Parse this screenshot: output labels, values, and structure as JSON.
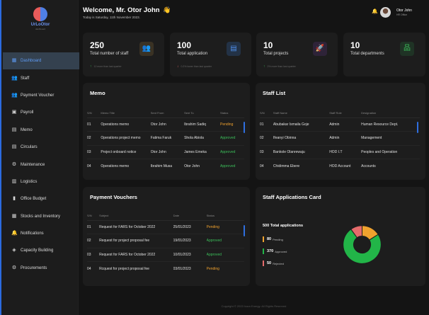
{
  "logo": {
    "title": "UrLoOtor",
    "subtitle": "dashboard"
  },
  "sidebar": {
    "items": [
      {
        "label": "Dashboard",
        "icon": "dashboard-icon",
        "glyph": "▦"
      },
      {
        "label": "Staff",
        "icon": "users-icon",
        "glyph": "👥"
      },
      {
        "label": "Payment Voucher",
        "icon": "users-icon",
        "glyph": "👥"
      },
      {
        "label": "Payroll",
        "icon": "document-icon",
        "glyph": "▣"
      },
      {
        "label": "Memo",
        "icon": "folder-icon",
        "glyph": "▤"
      },
      {
        "label": "Circulars",
        "icon": "folder-icon",
        "glyph": "▤"
      },
      {
        "label": "Maintenance",
        "icon": "wrench-icon",
        "glyph": "⚙"
      },
      {
        "label": "Logistics",
        "icon": "truck-icon",
        "glyph": "▥"
      },
      {
        "label": "Office Budget",
        "icon": "budget-icon",
        "glyph": "▮"
      },
      {
        "label": "Stocks and Inventory",
        "icon": "inventory-icon",
        "glyph": "▦"
      },
      {
        "label": "Notifications",
        "icon": "bell-icon",
        "glyph": "🔔"
      },
      {
        "label": "Capacity Building",
        "icon": "capacity-icon",
        "glyph": "◈"
      },
      {
        "label": "Procurements",
        "icon": "procurement-icon",
        "glyph": "⚙"
      }
    ]
  },
  "header": {
    "welcome": "Welcome, Mr. Otor John",
    "hand": "👋",
    "date": "Today is Saturday, 11th November 2023.",
    "user_name": "Otor John",
    "user_role": "HR Office"
  },
  "stats": [
    {
      "value": "250",
      "label": "Total number of staff",
      "trend": "12 more than last quarter",
      "trend_dir": "up",
      "icon": "staff-group-icon",
      "glyph": "👥",
      "icon_bg": "#3a3224",
      "icon_color": "#f3b43a"
    },
    {
      "value": "100",
      "label": "Total application",
      "trend": "0.2% lower than last quarter",
      "trend_dir": "down",
      "icon": "application-icon",
      "glyph": "▤",
      "icon_bg": "#233246",
      "icon_color": "#4f8fea"
    },
    {
      "value": "10",
      "label": "Total projects",
      "trend": "2% more than last quarter",
      "trend_dir": "up",
      "icon": "rocket-icon",
      "glyph": "🚀",
      "icon_bg": "#2e2338",
      "icon_color": "#a36bdd"
    },
    {
      "value": "10",
      "label": "Total departments",
      "trend": "",
      "trend_dir": "",
      "icon": "org-chart-icon",
      "glyph": "品",
      "icon_bg": "#1f3325",
      "icon_color": "#3cbf5a"
    }
  ],
  "memo": {
    "title": "Memo",
    "columns": [
      "S/N",
      "Memo Title",
      "Sent From",
      "Sent To",
      "Status"
    ],
    "rows": [
      {
        "sn": "01",
        "title": "Operations memo",
        "from": "Otor John",
        "to": "Ibrahim Sadiq",
        "status": "Pending",
        "type": "pending"
      },
      {
        "sn": "02",
        "title": "Operations project memo",
        "from": "Fatima Faruk",
        "to": "Shola Abiola",
        "status": "Approved",
        "type": "approved"
      },
      {
        "sn": "03",
        "title": "Project onboard notice",
        "from": "Otor John",
        "to": "James Emeka",
        "status": "Approved",
        "type": "approved"
      },
      {
        "sn": "04",
        "title": "Operations memo",
        "from": "Ibrahim Musa",
        "to": "Otor John",
        "status": "Approved",
        "type": "approved"
      }
    ]
  },
  "staff": {
    "title": "Staff List",
    "columns": [
      "S/N",
      "Staff Name",
      "Staff Role",
      "Designation"
    ],
    "rows": [
      {
        "sn": "01",
        "name": "Abubakar Ismaila Goje",
        "role": "Admin",
        "designation": "Human Resource Dept."
      },
      {
        "sn": "02",
        "name": "Ifeanyi Obinna",
        "role": "Admin",
        "designation": "Management"
      },
      {
        "sn": "03",
        "name": "Bankole Olanrewaju",
        "role": "HOD I.T",
        "designation": "Peoples and Operation"
      },
      {
        "sn": "04",
        "name": "Chidimma Ebere",
        "role": "HOD Account",
        "designation": "Accounts"
      }
    ]
  },
  "vouchers": {
    "title": "Payment Vouchers",
    "columns": [
      "S/N",
      "Subject",
      "Date",
      "Status"
    ],
    "rows": [
      {
        "sn": "01",
        "subject": "Request for FARS for October 2022",
        "date": "25/01/2023",
        "status": "Pending",
        "type": "pending"
      },
      {
        "sn": "02",
        "subject": "Request for project proposal fee",
        "date": "19/01/2023",
        "status": "Approved",
        "type": "approved"
      },
      {
        "sn": "03",
        "subject": "Request for FARS for October 2022",
        "date": "10/01/2023",
        "status": "Approved",
        "type": "approved"
      },
      {
        "sn": "04",
        "subject": "Rcquest for project proposal fee",
        "date": "03/01/2023",
        "status": "Pending",
        "type": "pending"
      }
    ]
  },
  "applications": {
    "title": "Staff Applications Card",
    "total_text": "500 Total applications",
    "items": [
      {
        "value": "80",
        "label": "Pending",
        "color": "#f0a22e"
      },
      {
        "value": "370",
        "label": "Approved",
        "color": "#22b548"
      },
      {
        "value": "50",
        "label": "Rejected",
        "color": "#e56b6b"
      }
    ]
  },
  "chart_data": {
    "type": "pie",
    "title": "Staff Applications Card",
    "categories": [
      "Pending",
      "Approved",
      "Rejected"
    ],
    "values": [
      80,
      370,
      50
    ],
    "colors": [
      "#f0a22e",
      "#22b548",
      "#e56b6b"
    ]
  },
  "footer": "Copyright © 2023 Ixora Energy. All Rights Reserved"
}
